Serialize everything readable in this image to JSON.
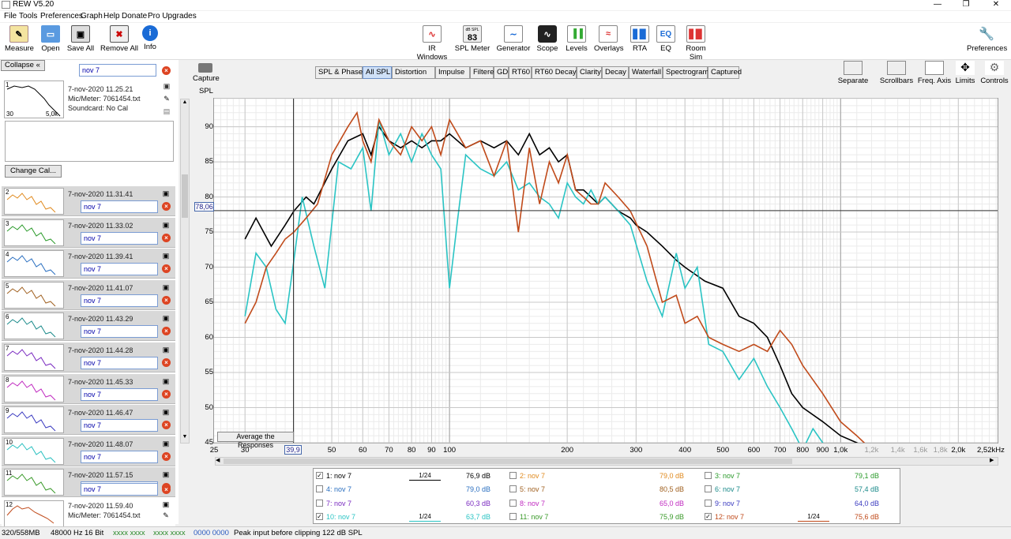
{
  "window": {
    "title": "REW V5.20"
  },
  "menu": [
    "File",
    "Tools",
    "Preferences",
    "Graph",
    "Help",
    "Donate",
    "Pro Upgrades"
  ],
  "toolbar_left": [
    {
      "label": "Measure",
      "icon": "measure-icon"
    },
    {
      "label": "Open",
      "icon": "folder-icon"
    },
    {
      "label": "Save All",
      "icon": "save-icon"
    },
    {
      "label": "Remove All",
      "icon": "remove-icon"
    },
    {
      "label": "Info",
      "icon": "info-icon"
    }
  ],
  "toolbar_center": [
    {
      "label": "IR Windows",
      "icon": "ir-windows-icon",
      "color": "#d33"
    },
    {
      "label": "SPL Meter",
      "icon": "spl-meter-icon",
      "badge": "dB SPL",
      "value": "83"
    },
    {
      "label": "Generator",
      "icon": "generator-icon",
      "color": "#1a6bd6"
    },
    {
      "label": "Scope",
      "icon": "scope-icon",
      "color": "#222"
    },
    {
      "label": "Levels",
      "icon": "levels-icon",
      "color": "#3a3"
    },
    {
      "label": "Overlays",
      "icon": "overlays-icon",
      "color": "#d33"
    },
    {
      "label": "RTA",
      "icon": "rta-icon",
      "color": "#1a6bd6"
    },
    {
      "label": "EQ",
      "icon": "eq-icon",
      "color": "#1a6bd6"
    },
    {
      "label": "Room Sim",
      "icon": "room-sim-icon",
      "color": "#d33"
    }
  ],
  "toolbar_right": {
    "label": "Preferences",
    "icon": "wrench-icon"
  },
  "left": {
    "collapse_label": "Collapse",
    "change_cal_label": "Change Cal...",
    "first": {
      "num": "1",
      "name": "nov 7",
      "date": "7-nov-2020 11.25.21",
      "mic": "Mic/Meter: 7061454.txt",
      "soundcard": "Soundcard: No Cal",
      "thumb_lo": "30",
      "thumb_hi": "5,0k"
    },
    "items": [
      {
        "num": "2",
        "name": "nov 7",
        "date": "7-nov-2020 11.31.41",
        "color": "#e08a1e"
      },
      {
        "num": "3",
        "name": "nov 7",
        "date": "7-nov-2020 11.33.02",
        "color": "#2a9a2a"
      },
      {
        "num": "4",
        "name": "nov 7",
        "date": "7-nov-2020 11.39.41",
        "color": "#2a6fc0"
      },
      {
        "num": "5",
        "name": "nov 7",
        "date": "7-nov-2020 11.41.07",
        "color": "#a06020"
      },
      {
        "num": "6",
        "name": "nov 7",
        "date": "7-nov-2020 11.43.29",
        "color": "#1a8a8a"
      },
      {
        "num": "7",
        "name": "nov 7",
        "date": "7-nov-2020 11.44.28",
        "color": "#7a2ac0"
      },
      {
        "num": "8",
        "name": "nov 7",
        "date": "7-nov-2020 11.45.33",
        "color": "#c02ac0"
      },
      {
        "num": "9",
        "name": "nov 7",
        "date": "7-nov-2020 11.46.47",
        "color": "#3a3ac0"
      },
      {
        "num": "10",
        "name": "nov 7",
        "date": "7-nov-2020 11.48.07",
        "color": "#2ac0c0"
      },
      {
        "num": "11",
        "name": "nov 7",
        "date": "7-nov-2020 11.57.15",
        "color": "#3a9a2a"
      }
    ],
    "last": {
      "num": "12",
      "name": "nov 7",
      "date": "7-nov-2020 11.59.40",
      "mic": "Mic/Meter: 7061454.txt",
      "color": "#c04a1a"
    }
  },
  "capture_label": "Capture",
  "tabs": [
    "SPL & Phase",
    "All SPL",
    "Distortion",
    "Impulse",
    "Filtered IR",
    "GD",
    "RT60",
    "RT60 Decay",
    "Clarity",
    "Decay",
    "Waterfall",
    "Spectrogram",
    "Captured"
  ],
  "selected_tab": "All SPL",
  "right_tools": [
    {
      "label": "Separate",
      "icon": "separate-icon"
    },
    {
      "label": "Scrollbars",
      "icon": "scrollbars-icon"
    },
    {
      "label": "Freq. Axis",
      "icon": "freq-axis-icon"
    },
    {
      "label": "Limits",
      "icon": "limits-icon"
    },
    {
      "label": "Controls",
      "icon": "gear-icon"
    }
  ],
  "chart_data": {
    "type": "line",
    "title": "",
    "ylabel": "SPL",
    "xlabel": "",
    "xscale": "log",
    "xlim": [
      25,
      2520
    ],
    "ylim": [
      45,
      94
    ],
    "grid": true,
    "y_ticks": [
      "90",
      "85",
      "80",
      "75",
      "70",
      "65",
      "60",
      "55",
      "50",
      "45"
    ],
    "x_ticks": [
      "25",
      "30",
      "40",
      "50",
      "60",
      "70",
      "80",
      "90",
      "100",
      "200",
      "300",
      "400",
      "500",
      "600",
      "700",
      "800",
      "900",
      "1,0k",
      "1,2k",
      "1,4k",
      "1,6k",
      "1,8k",
      "2,0k",
      "2,52kHz"
    ],
    "cursor_y_label": "78,06",
    "cursor_x_label": "39,9",
    "cursor": {
      "x": 39.9,
      "y": 78.06
    },
    "average_button": "Average the Responses",
    "series": [
      {
        "name": "1: nov 7",
        "color": "#000000",
        "x": [
          30,
          32,
          35,
          38,
          40,
          43,
          45,
          50,
          55,
          60,
          63,
          66,
          70,
          75,
          80,
          85,
          90,
          95,
          100,
          110,
          120,
          130,
          140,
          150,
          160,
          170,
          180,
          190,
          200,
          210,
          220,
          230,
          240,
          250,
          270,
          290,
          300,
          320,
          350,
          380,
          400,
          450,
          500,
          550,
          600,
          650,
          700,
          750,
          800,
          900,
          1000,
          1100,
          1200
        ],
        "y": [
          74,
          77,
          73,
          76,
          78,
          80,
          79,
          84,
          88,
          89,
          86,
          90,
          88,
          87,
          88,
          87,
          88,
          88,
          89,
          87,
          88,
          87,
          88,
          86,
          89,
          86,
          87,
          85,
          86,
          81,
          81,
          80,
          79,
          80,
          78,
          77,
          76,
          75,
          73,
          71,
          70,
          68,
          67,
          63,
          62,
          60,
          56,
          52,
          50,
          48,
          46,
          45,
          44
        ]
      },
      {
        "name": "10: nov 7",
        "color": "#2ac4c4",
        "x": [
          30,
          32,
          34,
          36,
          38,
          40,
          42,
          45,
          48,
          52,
          56,
          60,
          63,
          66,
          70,
          75,
          80,
          85,
          90,
          95,
          100,
          105,
          110,
          120,
          130,
          140,
          150,
          160,
          170,
          180,
          190,
          200,
          210,
          220,
          230,
          240,
          250,
          270,
          290,
          320,
          350,
          380,
          400,
          430,
          460,
          500,
          550,
          600,
          650,
          700,
          750,
          800,
          850,
          900,
          950,
          1000,
          1050,
          1100
        ],
        "y": [
          63,
          72,
          70,
          64,
          62,
          71,
          80,
          73,
          67,
          85,
          84,
          87,
          78,
          91,
          86,
          89,
          85,
          89,
          86,
          84,
          67,
          77,
          86,
          84,
          83,
          85,
          81,
          82,
          80,
          79,
          77,
          82,
          80,
          79,
          81,
          79,
          80,
          78,
          76,
          68,
          63,
          72,
          67,
          70,
          59,
          58,
          54,
          57,
          53,
          50,
          47,
          44,
          47,
          45,
          42,
          43,
          44,
          40
        ]
      },
      {
        "name": "12: nov 7",
        "color": "#c04a1a",
        "x": [
          30,
          32,
          34,
          36,
          38,
          40,
          43,
          46,
          50,
          55,
          58,
          60,
          63,
          66,
          70,
          75,
          80,
          85,
          90,
          95,
          100,
          110,
          120,
          130,
          140,
          150,
          160,
          170,
          180,
          190,
          200,
          210,
          220,
          230,
          240,
          250,
          270,
          290,
          320,
          350,
          380,
          400,
          430,
          460,
          500,
          550,
          600,
          650,
          700,
          750,
          800,
          900,
          1000,
          1100,
          1200
        ],
        "y": [
          62,
          65,
          70,
          72,
          74,
          75,
          77,
          79,
          86,
          90,
          92,
          88,
          85,
          91,
          88,
          86,
          90,
          88,
          90,
          86,
          91,
          87,
          88,
          83,
          88,
          75,
          87,
          79,
          85,
          82,
          86,
          81,
          80,
          79,
          79,
          82,
          80,
          78,
          73,
          65,
          66,
          62,
          63,
          60,
          59,
          58,
          59,
          58,
          61,
          59,
          56,
          52,
          48,
          46,
          44
        ]
      }
    ]
  },
  "legend": [
    {
      "label": "1: nov 7",
      "checked": true,
      "color": "#000000",
      "smooth": "1/24",
      "value": "76,9 dB"
    },
    {
      "label": "2: nov 7",
      "checked": false,
      "color": "#e08a1e",
      "value": "79,0 dB"
    },
    {
      "label": "3: nov 7",
      "checked": false,
      "color": "#2a9a2a",
      "value": "79,1 dB"
    },
    {
      "label": "4: nov 7",
      "checked": false,
      "color": "#2a6fc0",
      "value": "79,0 dB"
    },
    {
      "label": "5: nov 7",
      "checked": false,
      "color": "#a06020",
      "value": "80,5 dB"
    },
    {
      "label": "6: nov 7",
      "checked": false,
      "color": "#1a8a8a",
      "value": "57,4 dB"
    },
    {
      "label": "7: nov 7",
      "checked": false,
      "color": "#7a2ac0",
      "value": "60,3 dB"
    },
    {
      "label": "8: nov 7",
      "checked": false,
      "color": "#c02ac0",
      "value": "65,0 dB"
    },
    {
      "label": "9: nov 7",
      "checked": false,
      "color": "#3a3ac0",
      "value": "64,0 dB"
    },
    {
      "label": "10: nov 7",
      "checked": true,
      "color": "#2ac4c4",
      "smooth": "1/24",
      "value": "63,7 dB"
    },
    {
      "label": "11: nov 7",
      "checked": false,
      "color": "#3a9a2a",
      "value": "75,9 dB"
    },
    {
      "label": "12: nov 7",
      "checked": true,
      "color": "#c04a1a",
      "smooth": "1/24",
      "value": "75,6 dB"
    }
  ],
  "status": {
    "memory": "320/558MB",
    "rate": "48000 Hz",
    "bits": "16 Bit",
    "in1": "xxxx xxxx",
    "in2": "xxxx xxxx",
    "in3": "0000 0000",
    "message": "Peak input before clipping 122 dB SPL"
  }
}
